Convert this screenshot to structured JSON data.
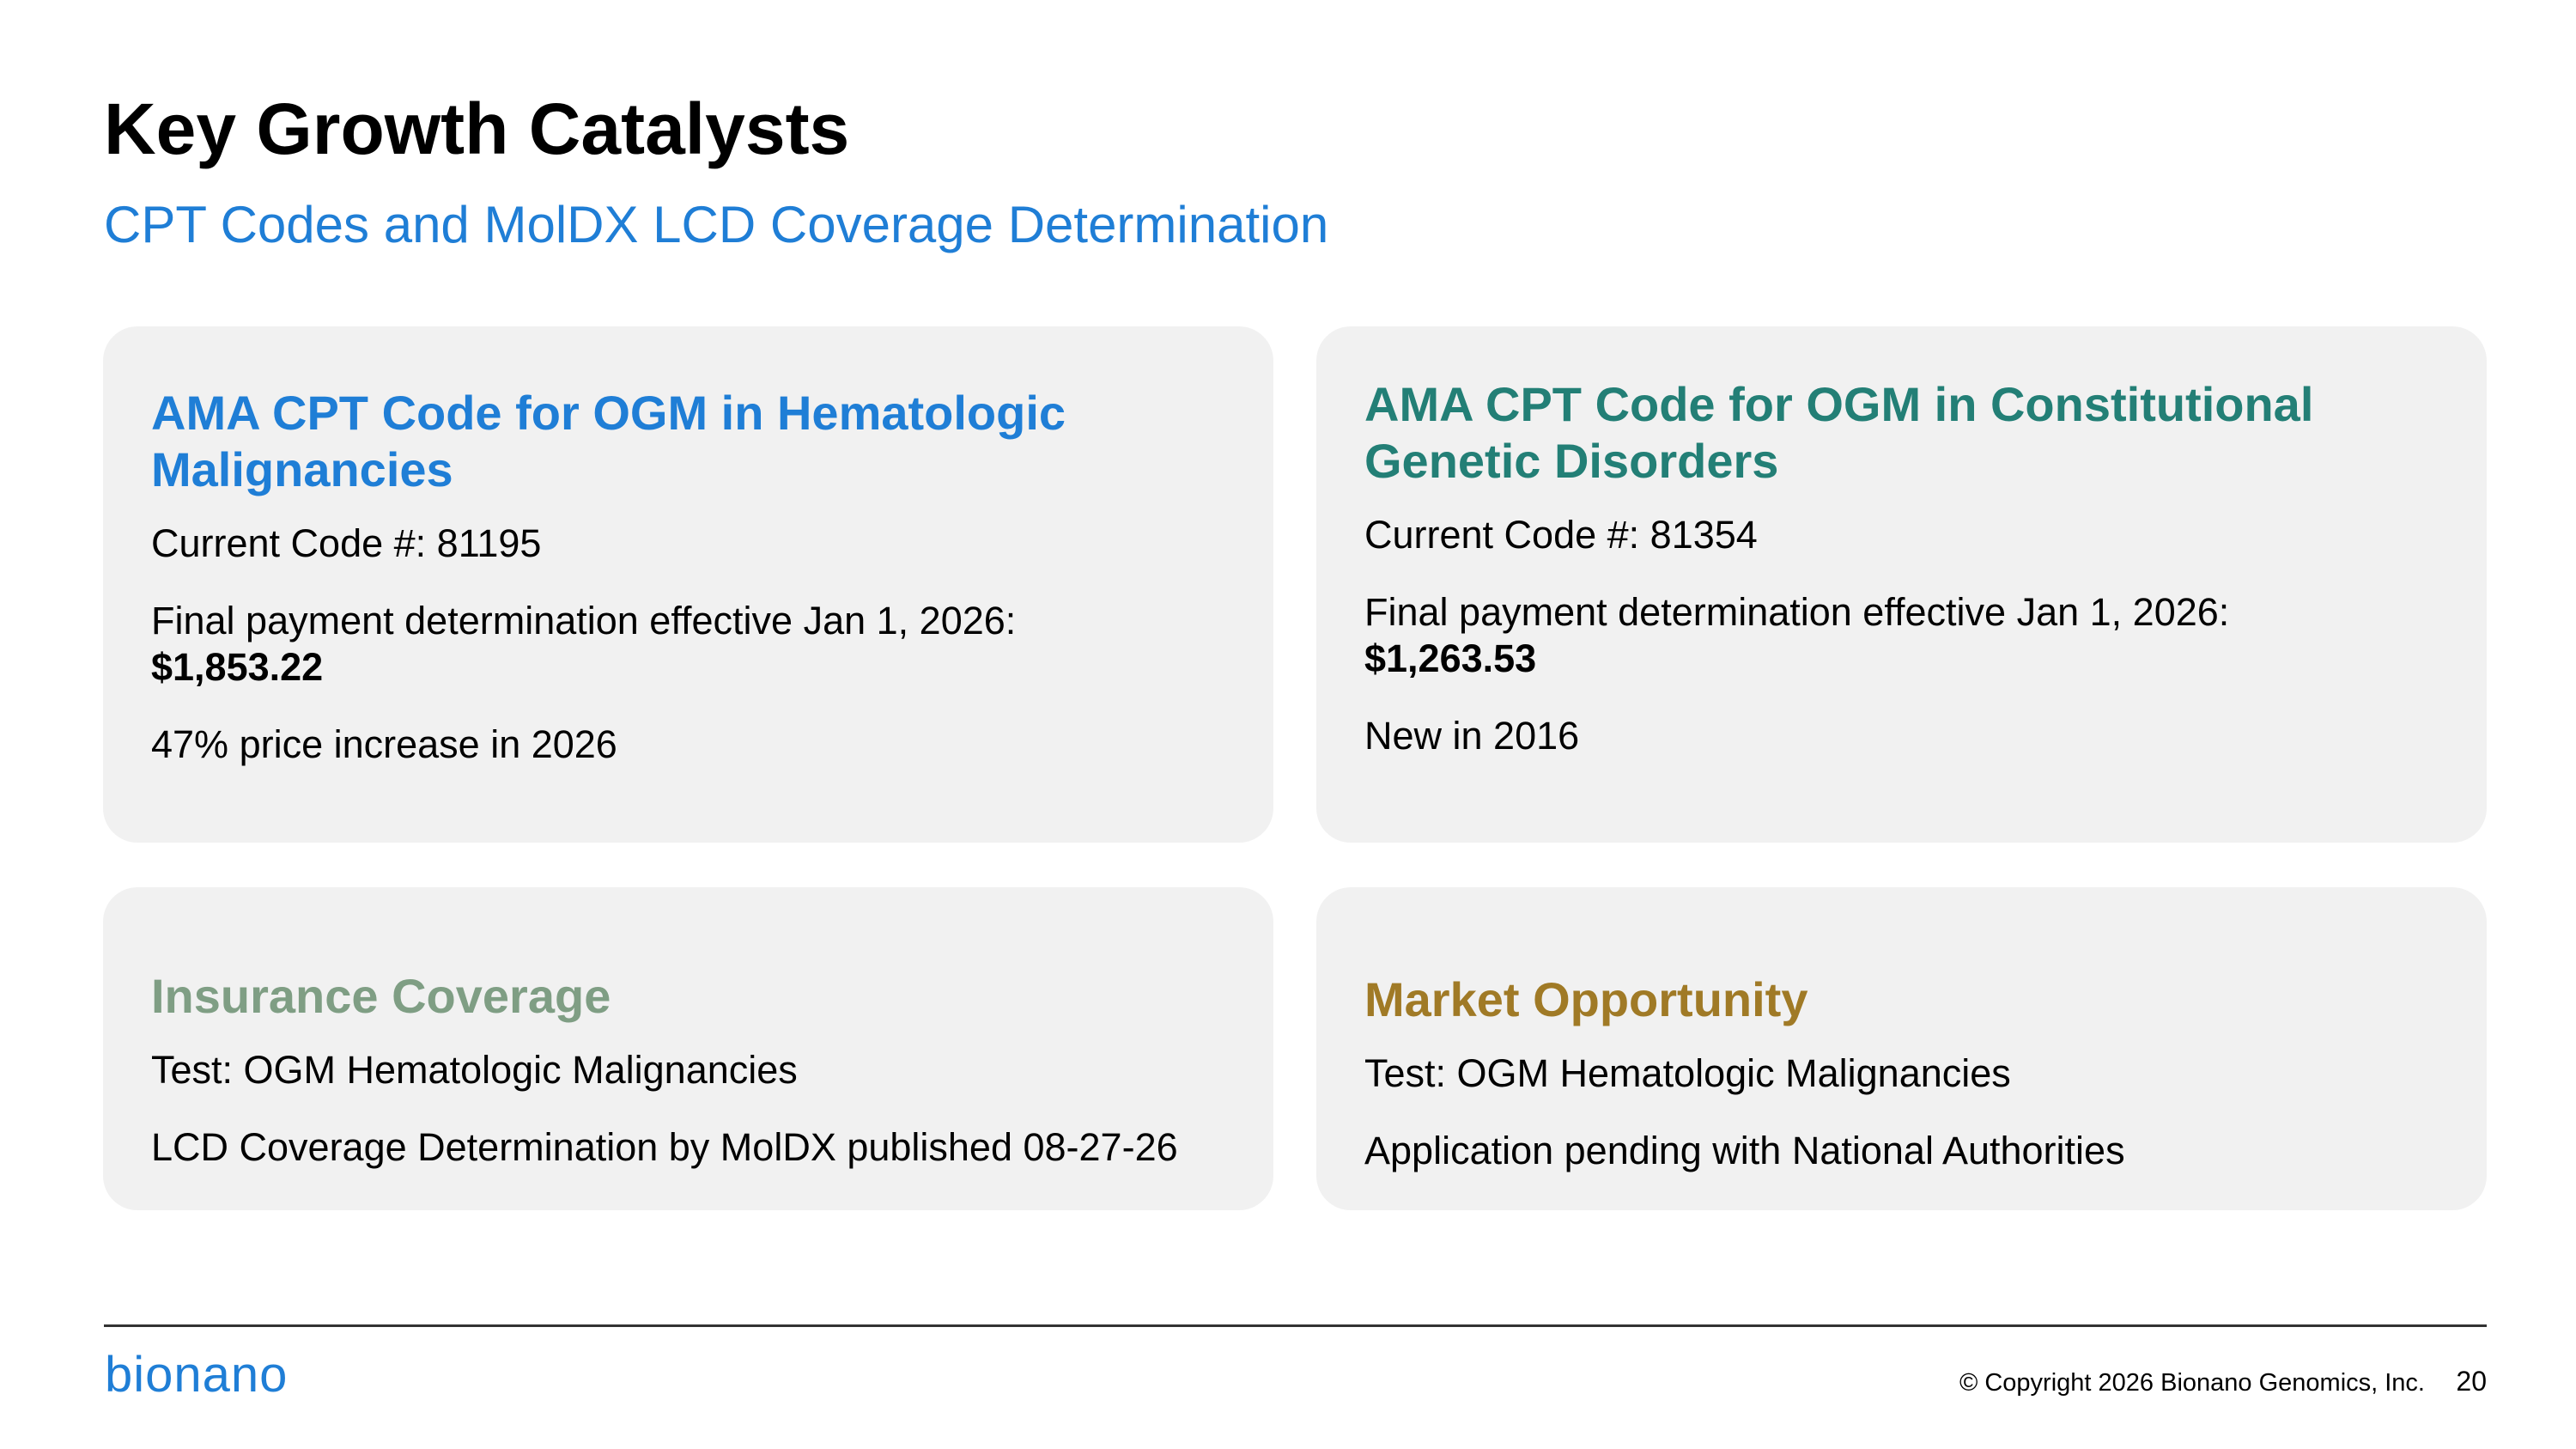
{
  "slide": {
    "title": "Key Growth Catalysts",
    "subtitle": "CPT Codes and MolDX LCD Coverage Determination"
  },
  "cards": {
    "hematologic": {
      "heading_line1": "AMA CPT Code for OGM in Hematologic",
      "heading_line2": "Malignancies",
      "current_code": "Current Code #: 81195",
      "payment_label": "Final payment determination effective Jan 1, 2026:",
      "payment_amount": "$1,853.22",
      "note": "47% price increase in 2026",
      "accent_color": "#1f7ed6"
    },
    "constitutional": {
      "heading_line1": "AMA CPT Code for OGM in Constitutional",
      "heading_line2": "Genetic Disorders",
      "current_code": "Current Code #: 81354",
      "payment_label": "Final payment determination effective Jan 1, 2026:",
      "payment_amount": "$1,263.53",
      "note": "New in 2016",
      "accent_color": "#237f76"
    },
    "insurance": {
      "heading": "Insurance Coverage",
      "test": "Test: OGM Hematologic Malignancies",
      "detail": "LCD Coverage Determination by MolDX published 08-27-26",
      "accent_color": "#7f9e84"
    },
    "market": {
      "heading": "Market Opportunity",
      "test": "Test: OGM Hematologic Malignancies",
      "detail": "Application pending with National Authorities",
      "accent_color": "#a07a26"
    }
  },
  "footer": {
    "logo": "bionano",
    "copyright": "© Copyright 2026 Bionano Genomics, Inc.",
    "page_number": "20"
  }
}
